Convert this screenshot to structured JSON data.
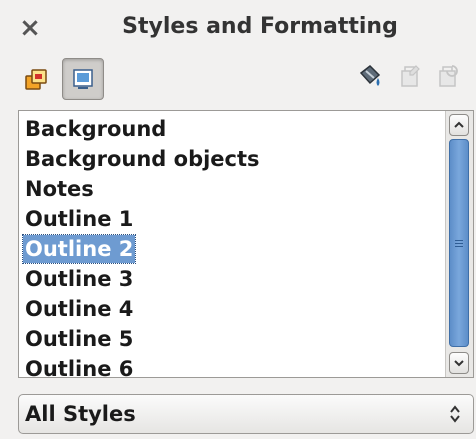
{
  "window": {
    "title": "Styles and Formatting",
    "close_glyph": "×"
  },
  "toolbar": {
    "buttons": [
      {
        "name": "graphics-styles",
        "icon": "graphics-styles-icon",
        "active": false
      },
      {
        "name": "presentation-styles",
        "icon": "presentation-styles-icon",
        "active": true
      },
      {
        "name": "fill-format-mode",
        "icon": "fill-format-mode-icon",
        "enabled": true
      },
      {
        "name": "new-style-from-selection",
        "icon": "new-style-from-selection-icon",
        "enabled": false
      },
      {
        "name": "update-style",
        "icon": "update-style-icon",
        "enabled": false
      }
    ]
  },
  "styles_list": {
    "items": [
      {
        "label": "Background",
        "selected": false
      },
      {
        "label": "Background objects",
        "selected": false
      },
      {
        "label": "Notes",
        "selected": false
      },
      {
        "label": "Outline 1",
        "selected": false
      },
      {
        "label": "Outline 2",
        "selected": true
      },
      {
        "label": "Outline 3",
        "selected": false
      },
      {
        "label": "Outline 4",
        "selected": false
      },
      {
        "label": "Outline 5",
        "selected": false
      },
      {
        "label": "Outline 6",
        "selected": false
      }
    ]
  },
  "filter": {
    "value": "All Styles"
  },
  "colors": {
    "selection": "#6e9bd1",
    "scroll_thumb": "#6a9ad4",
    "background": "#f2f1f0"
  }
}
